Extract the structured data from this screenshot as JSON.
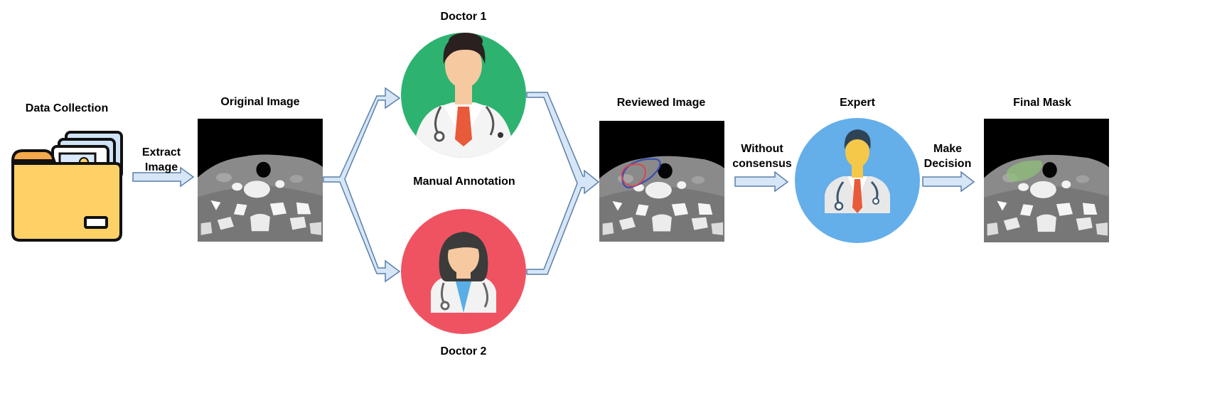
{
  "stages": {
    "data_collection": "Data Collection",
    "original_image": "Original Image",
    "doctor1": "Doctor 1",
    "doctor2": "Doctor 2",
    "manual_annotation": "Manual Annotation",
    "reviewed_image": "Reviewed Image",
    "expert": "Expert",
    "final_mask": "Final Mask"
  },
  "arrows": {
    "extract": [
      "Extract",
      "Image"
    ],
    "without": [
      "Without",
      "consensus"
    ],
    "decision": [
      "Make",
      "Decision"
    ]
  },
  "colors": {
    "arrow_fill": "#d6e6f7",
    "arrow_stroke": "#5a7fa8",
    "doctor1_bg": "#2db36f",
    "doctor2_bg": "#ef5362",
    "expert_bg": "#64aeea",
    "folder": "#fdd166",
    "annotation_blue": "#3b4fb0",
    "annotation_red": "#e0404a",
    "mask_green": "#8fbf7a"
  },
  "icons": [
    "folder-icon",
    "doctor-male-icon",
    "doctor-female-icon",
    "expert-icon",
    "ct-scan-image"
  ]
}
